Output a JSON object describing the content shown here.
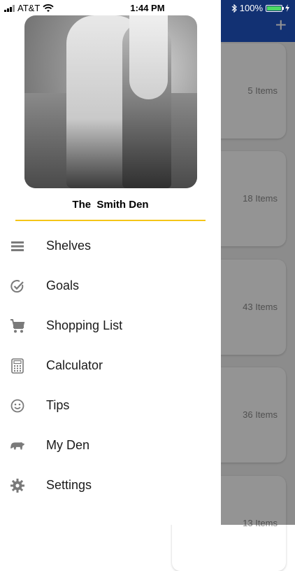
{
  "status_bar": {
    "carrier": "AT&T",
    "time": "1:44 PM",
    "battery": "100%",
    "battery_level": 1.0
  },
  "drawer": {
    "den_name": "The  Smith Den",
    "accent_color": "#f5c518",
    "menu": [
      {
        "label": "Shelves",
        "icon": "shelves-icon"
      },
      {
        "label": "Goals",
        "icon": "goals-check-icon"
      },
      {
        "label": "Shopping List",
        "icon": "shopping-cart-icon"
      },
      {
        "label": "Calculator",
        "icon": "calculator-icon"
      },
      {
        "label": "Tips",
        "icon": "smiley-icon"
      },
      {
        "label": "My Den",
        "icon": "bear-icon"
      },
      {
        "label": "Settings",
        "icon": "gear-icon"
      }
    ]
  },
  "background": {
    "nav_color": "#1f55c7",
    "add_label": "+",
    "cards": [
      {
        "count": "5 Items"
      },
      {
        "count": "18 Items"
      },
      {
        "count": "43 Items"
      },
      {
        "count": "36 Items"
      },
      {
        "count": "13 Items"
      }
    ]
  }
}
